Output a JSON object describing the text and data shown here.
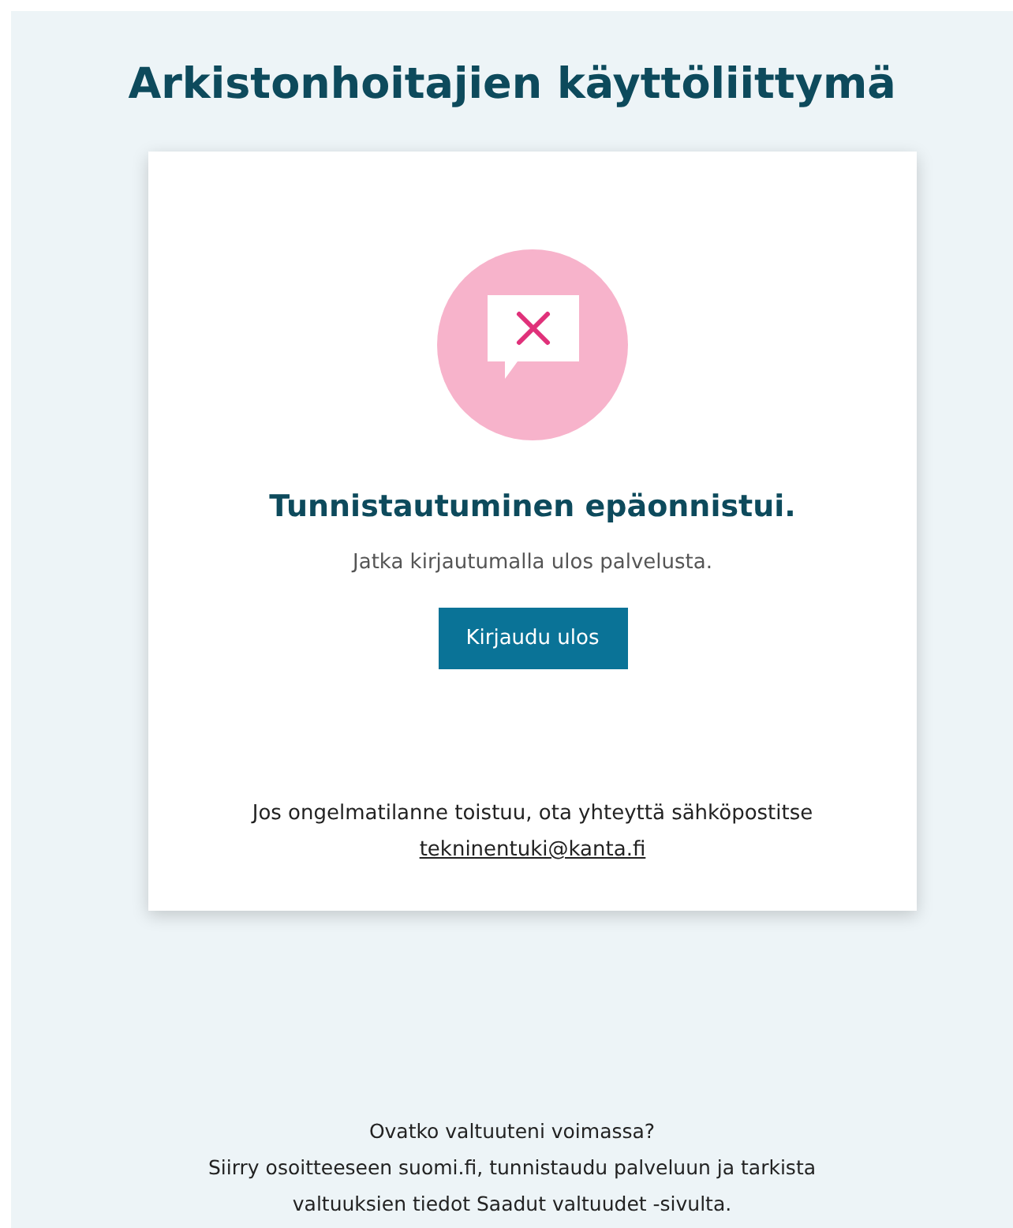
{
  "page_title": "Arkistonhoitajien käyttöliittymä",
  "card": {
    "kind": "error",
    "heading": "Tunnistautuminen epäonnistui.",
    "message": "Jatka kirjautumalla ulos palvelusta.",
    "button": "Kirjaudu ulos",
    "contact_text": "Jos ongelmatilanne toistuu, ota yhteyttä sähköpostitse",
    "contact_link": "tekninentuki@kanta.fi"
  },
  "footer": {
    "question": "Ovatko valtuuteni voimassa?",
    "instructions": "Siirry osoitteeseen suomi.fi, tunnistaudu palveluun ja tarkista valtuuksien tiedot Saadut valtuudet -sivulta."
  }
}
